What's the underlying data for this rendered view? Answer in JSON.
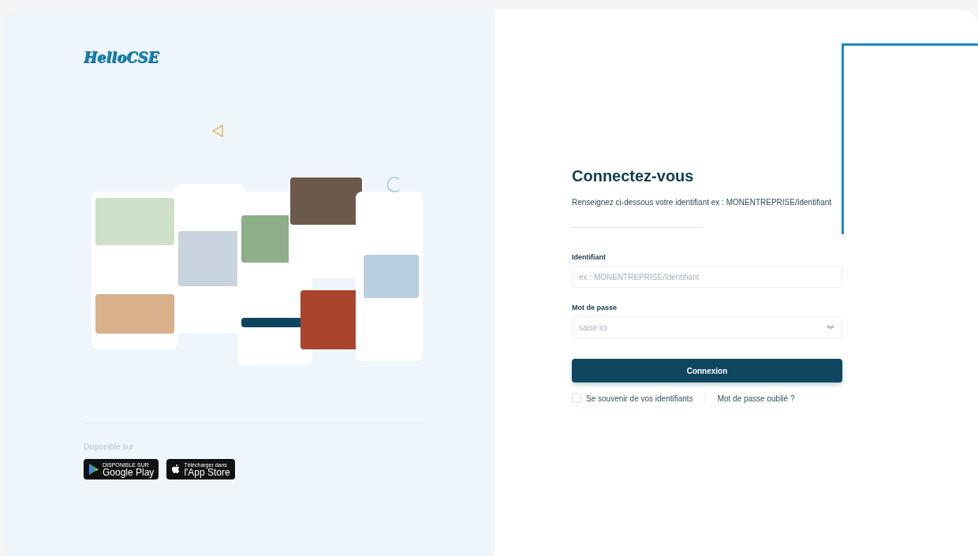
{
  "logo": {
    "text": "HelloCSE"
  },
  "store": {
    "caption": "Disponible sur",
    "badges": [
      {
        "kind": "google",
        "small": "DISPONIBLE SUR",
        "big": "Google Play"
      },
      {
        "kind": "apple",
        "small": "Télécharger dans",
        "big": "l'App Store"
      }
    ]
  },
  "login": {
    "title": "Connectez-vous",
    "subtitle": "Renseignez ci-dessous votre identifiant ex : MONENTREPRISE/Identifiant",
    "fields": [
      {
        "kind": "text",
        "label": "Identifiant",
        "placeholder": "ex : MONENTREPRISE/Identifiant"
      },
      {
        "kind": "password",
        "label": "Mot de passe",
        "placeholder": "saisir ici"
      }
    ],
    "submit": "Connexion",
    "remember": {
      "label": "Se souvenir de vos identifiants",
      "checked": false
    },
    "forgot": "Mot de passe oublié ?"
  }
}
